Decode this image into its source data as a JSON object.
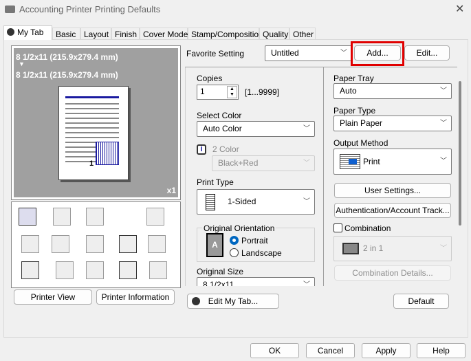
{
  "window": {
    "title": "Accounting Printer Printing Defaults",
    "close": "✕"
  },
  "tabs": [
    "My Tab",
    "Basic",
    "Layout",
    "Finish",
    "Cover Mode",
    "Stamp/Composition",
    "Quality",
    "Other"
  ],
  "preview": {
    "size_from": "8 1/2x11 (215.9x279.4 mm)",
    "arrow": "▼",
    "size_to": "8 1/2x11 (215.9x279.4 mm)",
    "copies_badge": "x1",
    "page_number": "1"
  },
  "left_buttons": {
    "printer_view": "Printer View",
    "printer_information": "Printer Information"
  },
  "favorite": {
    "label": "Favorite Setting",
    "value": "Untitled",
    "add": "Add...",
    "edit": "Edit..."
  },
  "copies": {
    "label": "Copies",
    "value": "1",
    "range": "[1...9999]"
  },
  "select_color": {
    "label": "Select Color",
    "value": "Auto Color"
  },
  "two_color": {
    "label": "2 Color",
    "value": "Black+Red",
    "info": "i"
  },
  "print_type": {
    "label": "Print Type",
    "value": "1-Sided"
  },
  "orientation": {
    "label": "Original Orientation",
    "options": [
      "Portrait",
      "Landscape"
    ],
    "selected": "Portrait"
  },
  "original_size": {
    "label": "Original Size",
    "value": "8 1/2x11"
  },
  "paper_tray": {
    "label": "Paper Tray",
    "value": "Auto"
  },
  "paper_type": {
    "label": "Paper Type",
    "value": "Plain Paper"
  },
  "output_method": {
    "label": "Output Method",
    "value": "Print"
  },
  "user_settings": "User Settings...",
  "authentication": "Authentication/Account Track...",
  "combination": {
    "label": "Combination",
    "checked": false,
    "value": "2 in 1",
    "details": "Combination Details..."
  },
  "edit_my_tab": "Edit My Tab...",
  "default": "Default",
  "footer": {
    "ok": "OK",
    "cancel": "Cancel",
    "apply": "Apply",
    "help": "Help"
  },
  "colors": {
    "highlight": "#e00000",
    "accent": "#0067c0",
    "preview_bg": "#a0a0a0"
  }
}
